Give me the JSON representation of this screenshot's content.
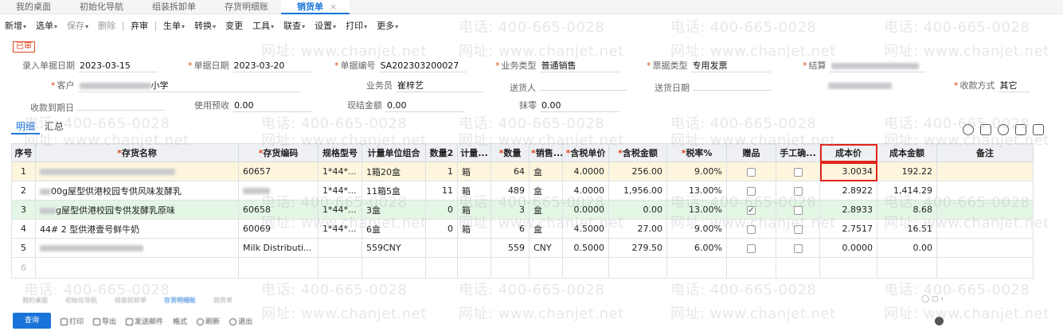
{
  "tabs": [
    {
      "label": "我的桌面"
    },
    {
      "label": "初始化导航"
    },
    {
      "label": "组装拆卸单"
    },
    {
      "label": "存货明细账"
    },
    {
      "label": "销货单",
      "active": true,
      "close": "×"
    }
  ],
  "toolbar": {
    "new": "新增",
    "select": "选单",
    "save": "保存",
    "delete": "删除",
    "unaudit": "弃审",
    "generate": "生单",
    "convert": "转换",
    "change": "变更",
    "tools": "工具",
    "linked": "联查",
    "settings": "设置",
    "print": "打印",
    "more": "更多",
    "caret": "▾"
  },
  "status_stamp": "已审",
  "header": {
    "entry_date": {
      "label": "录入单据日期",
      "value": "2023-03-15"
    },
    "doc_date": {
      "label": "单据日期",
      "value": "2023-03-20"
    },
    "doc_no": {
      "label": "单据编号",
      "value": "SA202303200027"
    },
    "biz_type": {
      "label": "业务类型",
      "value": "普通销售"
    },
    "invoice_type": {
      "label": "票据类型",
      "value": "专用发票"
    },
    "settle": {
      "label": "结算"
    },
    "customer": {
      "label": "客户",
      "value_suffix": "小学"
    },
    "salesman": {
      "label": "业务员",
      "value": "崔梓艺"
    },
    "deliver_to": {
      "label": "送货人"
    },
    "deliver_date": {
      "label": "送货日期"
    },
    "payment": {
      "label": "收款方式",
      "value": "其它"
    },
    "due_date": {
      "label": "收款到期日"
    },
    "prepay": {
      "label": "使用预收",
      "value": "0.00"
    },
    "cash": {
      "label": "现结金额",
      "value": "0.00"
    },
    "discount": {
      "label": "抹零",
      "value": "0.00"
    }
  },
  "subtabs": {
    "detail": "明细",
    "summary": "汇总"
  },
  "table": {
    "headers": {
      "seq": "序号",
      "name": "存货名称",
      "code": "存货编码",
      "spec": "规格型号",
      "unit_combo": "计量单位组合",
      "qty2": "数量2",
      "unit2": "计量...",
      "qty": "数量",
      "sale_unit": "销售...",
      "price": "含税单价",
      "amount": "含税金额",
      "tax": "税率%",
      "gift": "赠品",
      "manual": "手工确...",
      "cost_price": "成本价",
      "cost_amount": "成本金额",
      "note": "备注"
    },
    "rows": [
      {
        "seq": "1",
        "name": "",
        "code": "60657",
        "spec": "1*44*...",
        "unit_combo": "1箱20盒",
        "qty2": "1",
        "unit2": "箱",
        "qty": "64",
        "sale_unit": "盒",
        "price": "4.0000",
        "amount": "256.00",
        "tax": "9.00%",
        "gift": false,
        "manual": false,
        "cost_price": "3.0034",
        "cost_amount": "192.22"
      },
      {
        "seq": "2",
        "name": "00g屋型供港校园专供风味发酵乳",
        "code": "",
        "spec": "1*44*...",
        "unit_combo": "11箱5盒",
        "qty2": "11",
        "unit2": "箱",
        "qty": "489",
        "sale_unit": "盒",
        "price": "4.0000",
        "amount": "1,956.00",
        "tax": "13.00%",
        "gift": false,
        "manual": false,
        "cost_price": "2.8922",
        "cost_amount": "1,414.29"
      },
      {
        "seq": "3",
        "name": "g屋型供港校园专供发酵乳原味",
        "code": "60658",
        "spec": "1*44*...",
        "unit_combo": "3盒",
        "qty2": "0",
        "unit2": "箱",
        "qty": "3",
        "sale_unit": "盒",
        "price": "0.0000",
        "amount": "0.00",
        "tax": "13.00%",
        "gift": true,
        "manual": false,
        "cost_price": "2.8933",
        "cost_amount": "8.68"
      },
      {
        "seq": "4",
        "name": "44# 2  型供港壹号鲜牛奶",
        "code": "60069",
        "spec": "1*44*...",
        "unit_combo": "6盒",
        "qty2": "0",
        "unit2": "箱",
        "qty": "6",
        "sale_unit": "盒",
        "price": "4.5000",
        "amount": "27.00",
        "tax": "9.00%",
        "gift": false,
        "manual": false,
        "cost_price": "2.7517",
        "cost_amount": "16.51"
      },
      {
        "seq": "5",
        "name": "",
        "code": "Milk Distributi...",
        "spec": "",
        "unit_combo": "559CNY",
        "qty2": "",
        "unit2": "",
        "qty": "559",
        "sale_unit": "CNY",
        "price": "0.5000",
        "amount": "279.50",
        "tax": "6.00%",
        "gift": false,
        "manual": false,
        "cost_price": "0.0000",
        "cost_amount": "0.00"
      }
    ],
    "empty_row_seq": "6"
  },
  "bottom": {
    "query": "查询",
    "tools": [
      "打印",
      "导出",
      "发送邮件",
      "格式",
      "刷新",
      "退出"
    ]
  },
  "watermark": {
    "phone": "电话: 400-665-0028",
    "site": "网址: www.chanjet.net"
  },
  "colors": {
    "accent": "#1a73d9",
    "required": "#e0451f",
    "highlight_border": "#e2231a",
    "selected_row": "#fdf6dd",
    "gift_row": "#e4f6e4"
  }
}
